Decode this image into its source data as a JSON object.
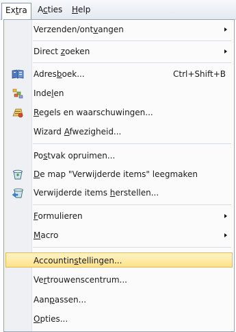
{
  "menubar": {
    "items": [
      {
        "pre": "Ex",
        "key": "t",
        "post": "ra"
      },
      {
        "pre": "A",
        "key": "c",
        "post": "ties"
      },
      {
        "pre": "",
        "key": "H",
        "post": "elp"
      }
    ]
  },
  "menu": {
    "items": [
      {
        "pre": "Verzenden/ont",
        "key": "v",
        "post": "angen",
        "submenu": true
      },
      {
        "pre": "Direct ",
        "key": "z",
        "post": "oeken",
        "submenu": true
      },
      {
        "pre": "Adres",
        "key": "b",
        "post": "oek...",
        "shortcut": "Ctrl+Shift+B",
        "icon": "address-book-icon"
      },
      {
        "pre": "Inde",
        "key": "l",
        "post": "en",
        "icon": "categorize-icon"
      },
      {
        "pre": "",
        "key": "R",
        "post": "egels en waarschuwingen...",
        "icon": "rules-alerts-icon"
      },
      {
        "pre": "Wizard ",
        "key": "A",
        "post": "fwezigheid..."
      },
      {
        "pre": "Po",
        "key": "s",
        "post": "tvak opruimen..."
      },
      {
        "pre": "",
        "key": "D",
        "post": "e map \"Verwijderde items\" leegmaken",
        "icon": "empty-deleted-items-icon"
      },
      {
        "pre": "Verwijderde items ",
        "key": "h",
        "post": "erstellen...",
        "icon": "recover-deleted-items-icon"
      },
      {
        "pre": "",
        "key": "F",
        "post": "ormulieren",
        "submenu": true
      },
      {
        "pre": "",
        "key": "M",
        "post": "acro",
        "submenu": true
      },
      {
        "pre": "Accountin",
        "key": "s",
        "post": "tellingen...",
        "highlighted": true
      },
      {
        "pre": "Ve",
        "key": "r",
        "post": "trouwenscentrum..."
      },
      {
        "pre": "Aan",
        "key": "p",
        "post": "assen..."
      },
      {
        "pre": "",
        "key": "O",
        "post": "pties..."
      }
    ]
  },
  "colors": {
    "highlight_top": "#fff4c8",
    "highlight_bottom": "#ffe28a",
    "highlight_border": "#e4b94f",
    "gutter": "#eef0f3",
    "menubar": "#e4e9f1"
  }
}
